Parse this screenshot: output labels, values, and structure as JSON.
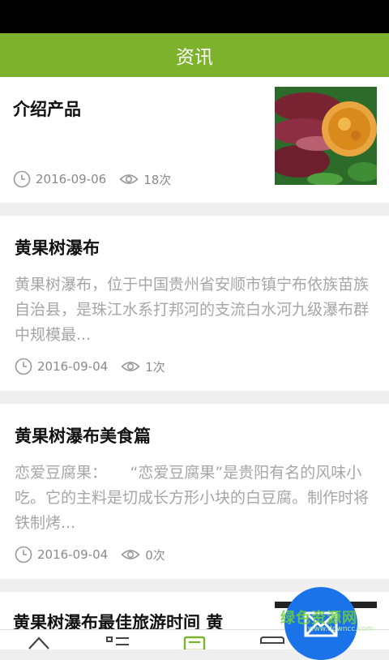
{
  "header": {
    "title": "资讯"
  },
  "articles": [
    {
      "title": "介绍产品",
      "summary": "",
      "date": "2016-09-06",
      "views": "18次"
    },
    {
      "title": "黄果树瀑布",
      "summary": "黄果树瀑布，位于中国贵州省安顺市镇宁布依族苗族自治县，是珠江水系打邦河的支流白水河九级瀑布群中规模最...",
      "date": "2016-09-04",
      "views": "1次"
    },
    {
      "title": "黄果树瀑布美食篇",
      "summary": "恋爱豆腐果：　　“恋爱豆腐果”是贵阳有名的风味小吃。它的主料是切成长方形小块的白豆腐。制作时将铁制烤...",
      "date": "2016-09-04",
      "views": "0次"
    },
    {
      "title": "黄果树瀑布最佳旅游时间  黄"
    }
  ],
  "watermark": {
    "text": "绿色资源网",
    "sub": "www.downcc.com"
  },
  "colors": {
    "header_bg": "#7cb22c",
    "fab": "#1a73e8",
    "background": "#efefef"
  },
  "icons": [
    "clock-icon",
    "eye-icon",
    "home-icon",
    "list-icon",
    "news-icon",
    "shop-icon",
    "mail-icon"
  ]
}
